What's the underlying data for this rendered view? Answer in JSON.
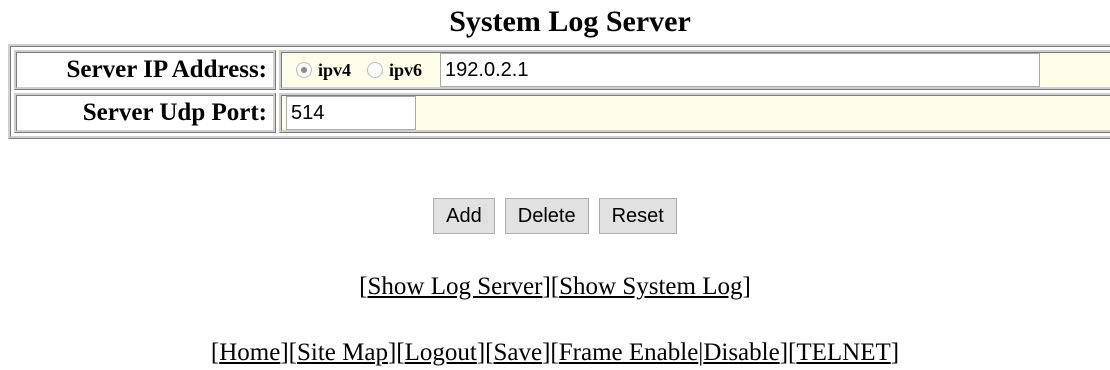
{
  "title": "System Log Server",
  "form": {
    "ip_label": "Server IP Address:",
    "ipv4_label": "ipv4",
    "ipv6_label": "ipv6",
    "ip_version_selected": "ipv4",
    "ip_value": "192.0.2.1",
    "port_label": "Server Udp Port:",
    "port_value": "514"
  },
  "buttons": {
    "add": "Add",
    "delete": "Delete",
    "reset": "Reset"
  },
  "links_row1": {
    "show_log_server": "Show Log Server",
    "show_system_log": "Show System Log"
  },
  "links_row2": {
    "home": "Home",
    "site_map": "Site Map",
    "logout": "Logout",
    "save": "Save",
    "frame_enable": "Frame Enable",
    "disable": "Disable",
    "telnet": "TELNET"
  },
  "colors": {
    "value_cell_bg": "#fffeea",
    "button_bg": "#e1e1e1"
  }
}
